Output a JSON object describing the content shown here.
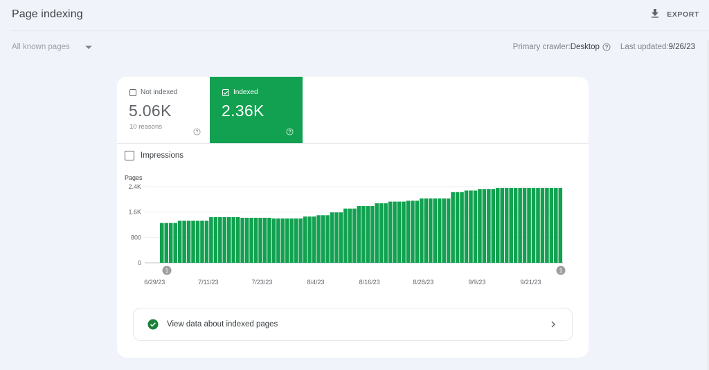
{
  "header": {
    "title": "Page indexing",
    "export_label": "EXPORT",
    "export_icon": "download-icon"
  },
  "filter": {
    "selected": "All known pages",
    "icon": "dropdown-caret-icon"
  },
  "meta": {
    "crawler_label": "Primary crawler: ",
    "crawler_value": "Desktop",
    "help_icon": "help-circle-icon",
    "updated_label": "Last updated: ",
    "updated_value": "9/26/23"
  },
  "summary": {
    "not_indexed": {
      "label": "Not indexed",
      "value": "5.06K",
      "sub": "10 reasons",
      "checked": false
    },
    "indexed": {
      "label": "Indexed",
      "value": "2.36K",
      "checked": true
    }
  },
  "impressions_toggle": {
    "label": "Impressions",
    "checked": false
  },
  "colors": {
    "accent_green": "#12a150",
    "background": "#f0f4fa"
  },
  "chart_data": {
    "type": "bar",
    "ylabel": "Pages",
    "ylim": [
      0,
      2400
    ],
    "yticks": [
      {
        "value": 0,
        "label": "0"
      },
      {
        "value": 800,
        "label": "800"
      },
      {
        "value": 1600,
        "label": "1.6K"
      },
      {
        "value": 2400,
        "label": "2.4K"
      }
    ],
    "xtick_labels": [
      "6/29/23",
      "7/11/23",
      "7/23/23",
      "8/4/23",
      "8/16/23",
      "8/28/23",
      "9/9/23",
      "9/21/23"
    ],
    "start_date": "6/29/23",
    "grid": true,
    "series": [
      {
        "name": "Indexed",
        "color": "#12a150",
        "values": [
          1260,
          1260,
          1260,
          1260,
          1330,
          1330,
          1330,
          1330,
          1330,
          1330,
          1330,
          1440,
          1440,
          1440,
          1440,
          1440,
          1440,
          1440,
          1420,
          1420,
          1420,
          1420,
          1420,
          1420,
          1420,
          1400,
          1400,
          1400,
          1400,
          1400,
          1400,
          1400,
          1460,
          1460,
          1460,
          1500,
          1500,
          1500,
          1590,
          1590,
          1590,
          1710,
          1710,
          1710,
          1790,
          1790,
          1790,
          1790,
          1880,
          1880,
          1880,
          1930,
          1930,
          1930,
          1930,
          1960,
          1960,
          1960,
          2030,
          2030,
          2030,
          2030,
          2030,
          2030,
          2030,
          2230,
          2230,
          2230,
          2280,
          2280,
          2280,
          2330,
          2330,
          2330,
          2330,
          2360,
          2360,
          2360,
          2360,
          2360,
          2360,
          2360,
          2360,
          2360,
          2360,
          2360,
          2360,
          2360,
          2360,
          2360
        ]
      }
    ],
    "annotations": [
      {
        "label": "1",
        "position": "start"
      },
      {
        "label": "1",
        "position": "end"
      }
    ]
  },
  "detail_link": {
    "label": "View data about indexed pages",
    "icon": "check-circle-icon",
    "chevron": "chevron-right-icon"
  }
}
